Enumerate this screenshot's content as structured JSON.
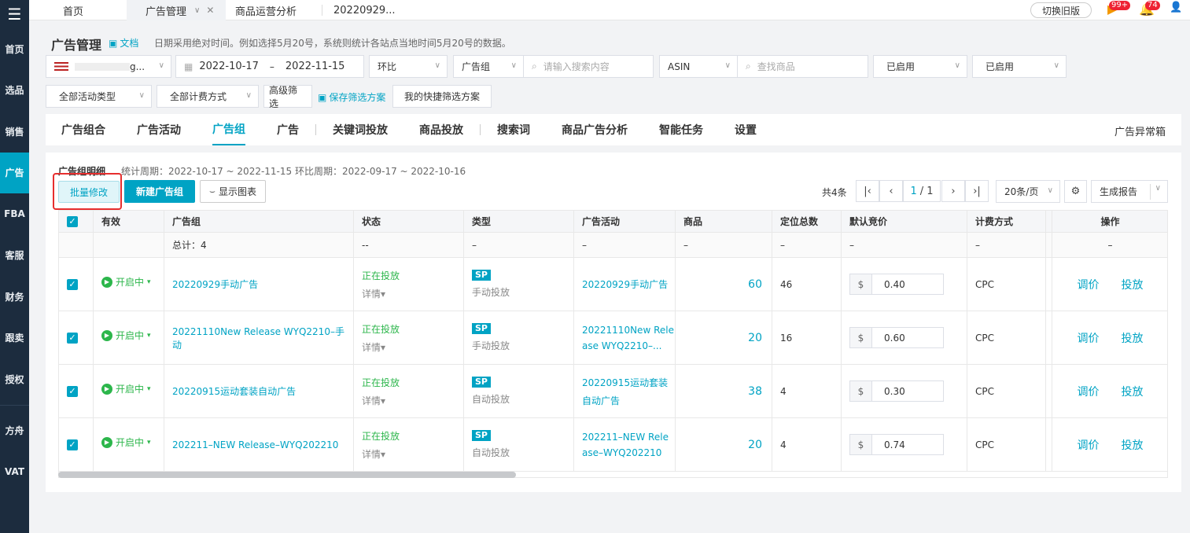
{
  "sidebar": {
    "logo": "☰",
    "items": [
      {
        "label": "首页",
        "active": false
      },
      {
        "label": "选品",
        "active": false
      },
      {
        "label": "销售",
        "active": false
      },
      {
        "label": "广告",
        "active": true
      },
      {
        "label": "FBA",
        "active": false
      },
      {
        "label": "客服",
        "active": false
      },
      {
        "label": "财务",
        "active": false
      },
      {
        "label": "跟卖",
        "active": false
      },
      {
        "label": "授权",
        "active": false
      },
      {
        "label": "方舟",
        "active": false
      },
      {
        "label": "VAT",
        "active": false
      }
    ]
  },
  "topbar": {
    "tabs": [
      "首页",
      "广告管理",
      "商品运营分析",
      "20220929..."
    ],
    "old_version": "切换旧版",
    "badge1": "99+",
    "badge2": "74"
  },
  "header": {
    "title": "广告管理",
    "doc": "文档",
    "note": "日期采用绝对时间。例如选择5月20号，系统则统计各站点当地时间5月20号的数据。"
  },
  "filters": {
    "store": "g...",
    "date_start": "2022-10-17",
    "date_sep": "–",
    "date_end": "2022-11-15",
    "compare": "环比",
    "group_select": "广告组",
    "search_placeholder": "请输入搜索内容",
    "asin": "ASIN",
    "product_placeholder": "查找商品",
    "status1": "已启用",
    "status2": "已启用",
    "activity_type": "全部活动类型",
    "billing": "全部计费方式",
    "advanced": "高级筛选",
    "save_plan": "保存筛选方案",
    "my_plans": "我的快捷筛选方案"
  },
  "tabs": {
    "items": [
      "广告组合",
      "广告活动",
      "广告组",
      "广告",
      "关键词投放",
      "商品投放",
      "搜索词",
      "商品广告分析",
      "智能任务",
      "设置"
    ],
    "right": "广告异常箱"
  },
  "content": {
    "sub_title": "广告组明细",
    "period": "统计周期：2022-10-17 ~ 2022-11-15 环比周期：2022-09-17 ~ 2022-10-16",
    "batch_edit": "批量修改",
    "new_group": "新建广告组",
    "show_chart": "显示图表",
    "total_count": "共4条",
    "page_current": "1",
    "page_total": "/ 1",
    "page_size": "20条/页",
    "report": "生成报告"
  },
  "table": {
    "headers": [
      "有效",
      "广告组",
      "状态",
      "类型",
      "广告活动",
      "商品",
      "定位总数",
      "默认竞价",
      "计费方式",
      "操作"
    ],
    "total_row": {
      "group": "总计：4",
      "status": "--",
      "type": "–",
      "activity": "–",
      "products": "–",
      "targets": "–",
      "bid": "–",
      "billing": "–",
      "ops": "–"
    },
    "rows": [
      {
        "enabled": "开启中",
        "group": "20220929手动广告",
        "status": "正在投放",
        "detail": "详情",
        "badge": "SP",
        "type": "手动投放",
        "activity_l1": "20220929手动广告",
        "activity_l2": "",
        "products": "60",
        "targets": "46",
        "currency": "$",
        "bid": "0.40",
        "billing": "CPC",
        "op1": "调价",
        "op2": "投放"
      },
      {
        "enabled": "开启中",
        "group": "20221110New Release WYQ2210–手动",
        "status": "正在投放",
        "detail": "详情",
        "badge": "SP",
        "type": "手动投放",
        "activity_l1": "20221110New Rele",
        "activity_l2": "ase WYQ2210–...",
        "products": "20",
        "targets": "16",
        "currency": "$",
        "bid": "0.60",
        "billing": "CPC",
        "op1": "调价",
        "op2": "投放"
      },
      {
        "enabled": "开启中",
        "group": "20220915运动套装自动广告",
        "status": "正在投放",
        "detail": "详情",
        "badge": "SP",
        "type": "自动投放",
        "activity_l1": "20220915运动套装",
        "activity_l2": "自动广告",
        "products": "38",
        "targets": "4",
        "currency": "$",
        "bid": "0.30",
        "billing": "CPC",
        "op1": "调价",
        "op2": "投放"
      },
      {
        "enabled": "开启中",
        "group": "202211–NEW Release–WYQ202210",
        "status": "正在投放",
        "detail": "详情",
        "badge": "SP",
        "type": "自动投放",
        "activity_l1": "202211–NEW Rele",
        "activity_l2": "ase–WYQ202210",
        "products": "20",
        "targets": "4",
        "currency": "$",
        "bid": "0.74",
        "billing": "CPC",
        "op1": "调价",
        "op2": "投放"
      }
    ]
  }
}
